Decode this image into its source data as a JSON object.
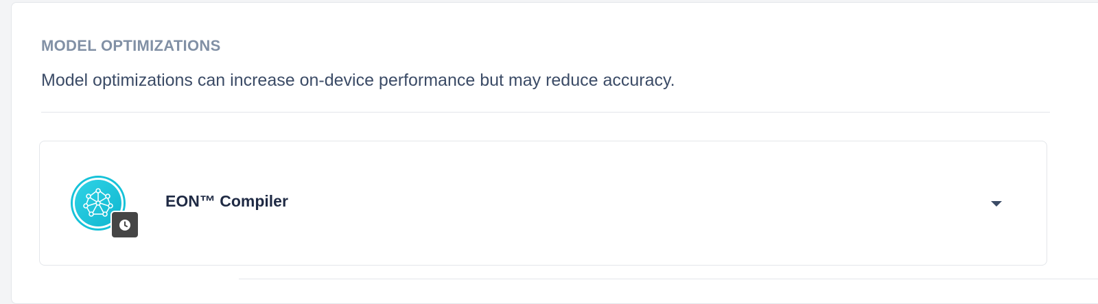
{
  "section": {
    "title": "MODEL OPTIMIZATIONS",
    "description": "Model optimizations can increase on-device performance but may reduce accuracy."
  },
  "optimization": {
    "title": "EON™ Compiler",
    "icon": "neural-network-icon",
    "badge_icon": "clock-icon",
    "expand_icon": "caret-down-icon"
  },
  "colors": {
    "section_title": "#8190a5",
    "description": "#3b4b66",
    "card_title": "#1f2a44",
    "icon_accent": "#16c2d8",
    "badge_bg": "#454545"
  }
}
